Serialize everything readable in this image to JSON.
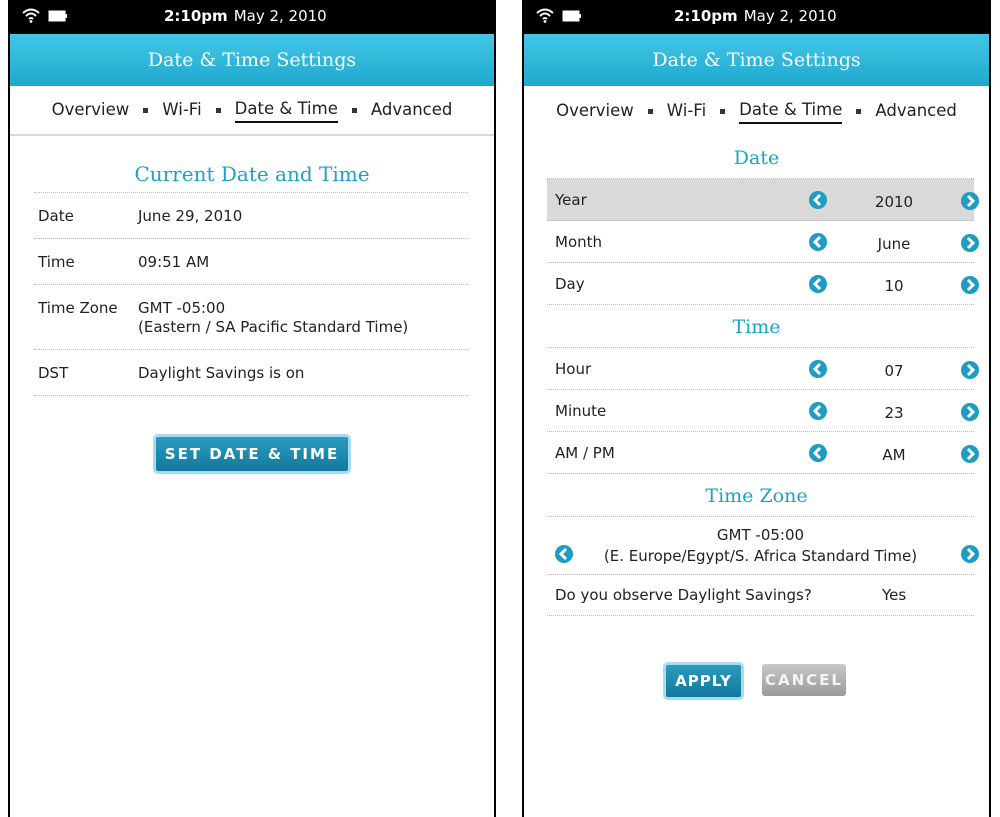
{
  "status_bar": {
    "time": "2:10pm",
    "date": "May 2, 2010"
  },
  "title": "Date & Time Settings",
  "tabs": [
    {
      "label": "Overview"
    },
    {
      "label": "Wi-Fi"
    },
    {
      "label": "Date & Time"
    },
    {
      "label": "Advanced"
    }
  ],
  "overview": {
    "heading": "Current Date and Time",
    "rows": [
      {
        "label": "Date",
        "value": "June 29, 2010",
        "value2": ""
      },
      {
        "label": "Time",
        "value": "09:51 AM",
        "value2": ""
      },
      {
        "label": "Time Zone",
        "value": "GMT -05:00",
        "value2": "(Eastern / SA Pacific Standard Time)"
      },
      {
        "label": "DST",
        "value": "Daylight Savings is on",
        "value2": ""
      }
    ],
    "set_button": "SET DATE & TIME"
  },
  "editor": {
    "date_heading": "Date",
    "date_rows": [
      {
        "label": "Year",
        "value": "2010"
      },
      {
        "label": "Month",
        "value": "June"
      },
      {
        "label": "Day",
        "value": "10"
      }
    ],
    "time_heading": "Time",
    "time_rows": [
      {
        "label": "Hour",
        "value": "07"
      },
      {
        "label": "Minute",
        "value": "23"
      },
      {
        "label": "AM / PM",
        "value": "AM"
      }
    ],
    "tz_heading": "Time Zone",
    "tz_gmt": "GMT -05:00",
    "tz_name": "(E. Europe/Egypt/S. Africa Standard Time)",
    "dst_question": "Do you observe Daylight Savings?",
    "dst_answer": "Yes",
    "apply_button": "APPLY",
    "cancel_button": "CANCEL"
  },
  "colors": {
    "accent": "#1aa3c8",
    "titlebar": "#2fb6dc",
    "button": "#1f8fb6",
    "disabled": "#b0b0b0"
  }
}
